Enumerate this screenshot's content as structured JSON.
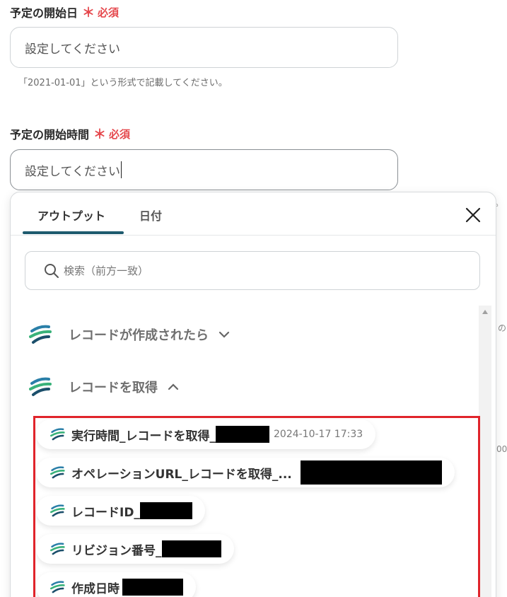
{
  "field1": {
    "label": "予定の開始日",
    "required_star": "＊",
    "required_text": "必須",
    "placeholder": "設定してください",
    "hint": "「2021-01-01」という形式で記載してください。"
  },
  "field2": {
    "label": "予定の開始時間",
    "required_star": "＊",
    "required_text": "必須",
    "value": "設定してください"
  },
  "background_fragments": {
    "period": "。",
    "no": "の",
    "zero": "00"
  },
  "popover": {
    "tabs": [
      {
        "label": "アウトプット",
        "active": true
      },
      {
        "label": "日付",
        "active": false
      }
    ],
    "search_placeholder": "検索（前方一致）",
    "groups": [
      {
        "label": "レコードが作成されたら",
        "expanded": false,
        "icon": "yoom-logo-icon"
      },
      {
        "label": "レコードを取得",
        "expanded": true,
        "icon": "yoom-logo-icon"
      }
    ],
    "items": [
      {
        "label": "実行時間_レコードを取得_",
        "meta": "2024-10-17 17:33"
      },
      {
        "label": "オペレーションURL_レコードを取得_..."
      },
      {
        "label": "レコードID_"
      },
      {
        "label": "リビジョン番号_"
      },
      {
        "label": "作成日時"
      }
    ]
  },
  "colors": {
    "required": "#e5484d",
    "tab_underline": "#1e5a6e",
    "highlight": "#e0242b"
  }
}
